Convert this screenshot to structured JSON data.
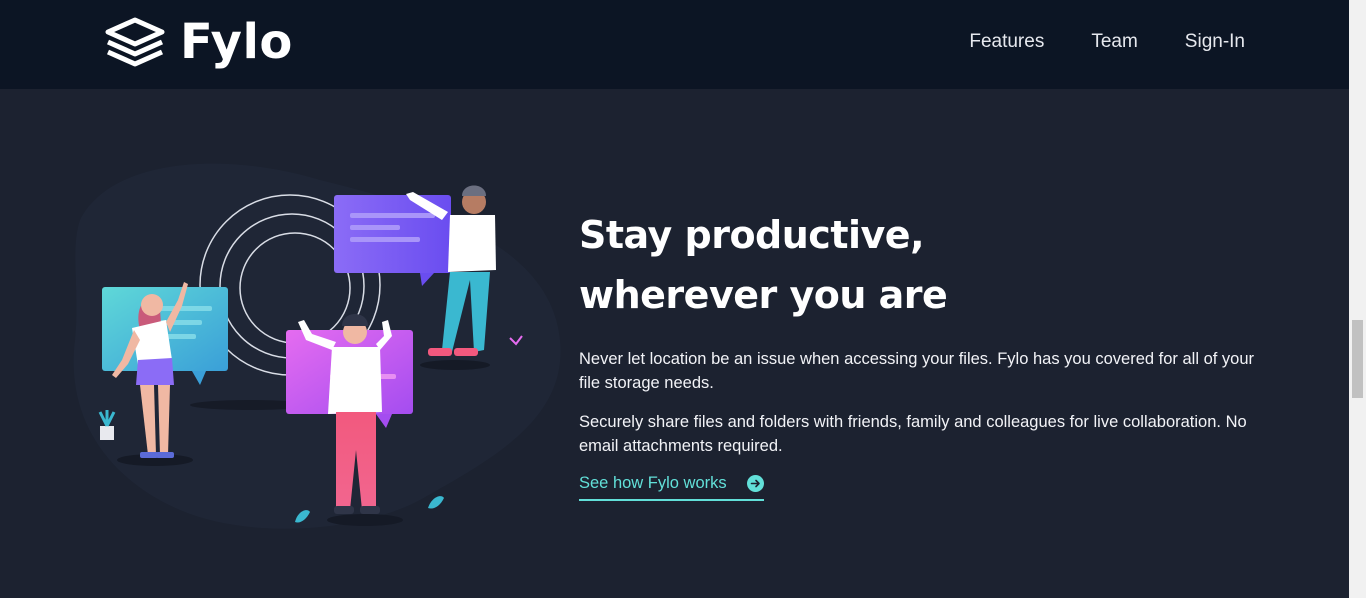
{
  "brand": {
    "name": "Fylo",
    "icon": "stacked-layers-icon"
  },
  "nav": {
    "items": [
      {
        "label": "Features"
      },
      {
        "label": "Team"
      },
      {
        "label": "Sign-In"
      }
    ]
  },
  "hero": {
    "headline_line1": "Stay productive,",
    "headline_line2": "wherever you are",
    "paragraph1": "Never let location be an issue when accessing your files. Fylo has you covered for all of your file storage needs.",
    "paragraph2": "Securely share files and folders with friends, family and colleagues for live collaboration. No email attachments required.",
    "cta_label": "See how Fylo works",
    "cta_icon": "arrow-circle-right-icon"
  },
  "colors": {
    "header_bg": "#0c1524",
    "page_bg": "#1c2230",
    "accent": "#62e0d9"
  }
}
